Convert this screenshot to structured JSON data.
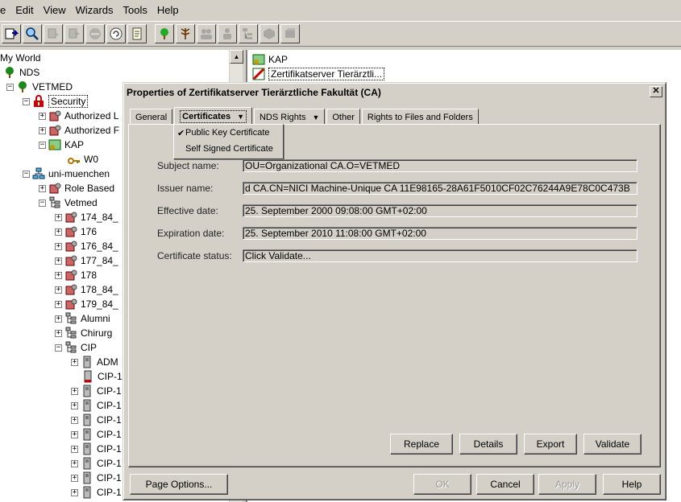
{
  "menubar": {
    "items": [
      "e",
      "Edit",
      "View",
      "Wizards",
      "Tools",
      "Help"
    ]
  },
  "toolbar": {
    "icons": [
      "tree-select-icon",
      "search-icon",
      "copy-icon",
      "move-icon",
      "delete-icon",
      "rename-icon",
      "details-icon",
      "tree-icon",
      "tree-edit-icon",
      "users-icon",
      "user-icon",
      "organize-icon",
      "object-icon",
      "partition-icon"
    ]
  },
  "tree": {
    "items": [
      {
        "label": "My World"
      },
      {
        "label": "NDS"
      },
      {
        "label": "VETMED"
      },
      {
        "label": "Security"
      },
      {
        "label": "Authorized L"
      },
      {
        "label": "Authorized F"
      },
      {
        "label": "KAP"
      },
      {
        "label": "W0"
      },
      {
        "label": "uni-muenchen"
      },
      {
        "label": "Role Based"
      },
      {
        "label": "Vetmed"
      },
      {
        "label": "174_84_"
      },
      {
        "label": "176"
      },
      {
        "label": "176_84_"
      },
      {
        "label": "177_84_"
      },
      {
        "label": "178"
      },
      {
        "label": "178_84_"
      },
      {
        "label": "179_84_"
      },
      {
        "label": "Alumni"
      },
      {
        "label": "Chirurg"
      },
      {
        "label": "CIP"
      },
      {
        "label": "ADM"
      },
      {
        "label": "CIP-1"
      },
      {
        "label": "CIP-1"
      },
      {
        "label": "CIP-1"
      },
      {
        "label": "CIP-1"
      },
      {
        "label": "CIP-1"
      },
      {
        "label": "CIP-1"
      },
      {
        "label": "CIP-1"
      },
      {
        "label": "CIP-1"
      },
      {
        "label": "CIP-1"
      }
    ]
  },
  "right_pane": {
    "items": [
      {
        "label": "KAP"
      },
      {
        "label": "Zertifikatserver Tierärztli..."
      }
    ]
  },
  "dialog": {
    "title": "Properties of Zertifikatserver Tierärztliche Fakultät (CA)",
    "tabs": [
      "General",
      "Certificates",
      "NDS Rights",
      "Other",
      "Rights to Files and Folders"
    ],
    "submenu": {
      "items": [
        "Public Key Certificate",
        "Self Signed Certificate"
      ],
      "checked_index": 0
    },
    "fields": {
      "subject": {
        "label": "Subject name:",
        "value": "OU=Organizational CA.O=VETMED"
      },
      "issuer": {
        "label": "Issuer name:",
        "value": "d CA.CN=NICI Machine-Unique CA 11E98165-28A61F5010CF02C76244A9E78C0C473B"
      },
      "effective": {
        "label": "Effective date:",
        "value": "25. September 2000 09:08:00 GMT+02:00"
      },
      "expiration": {
        "label": "Expiration date:",
        "value": "25. September 2010 11:08:00 GMT+02:00"
      },
      "status": {
        "label": "Certificate status:",
        "value": "Click Validate..."
      }
    },
    "buttons": {
      "replace": "Replace",
      "details": "Details",
      "export": "Export",
      "validate": "Validate",
      "page_options": "Page Options...",
      "ok": "OK",
      "cancel": "Cancel",
      "apply": "Apply",
      "help": "Help"
    }
  }
}
